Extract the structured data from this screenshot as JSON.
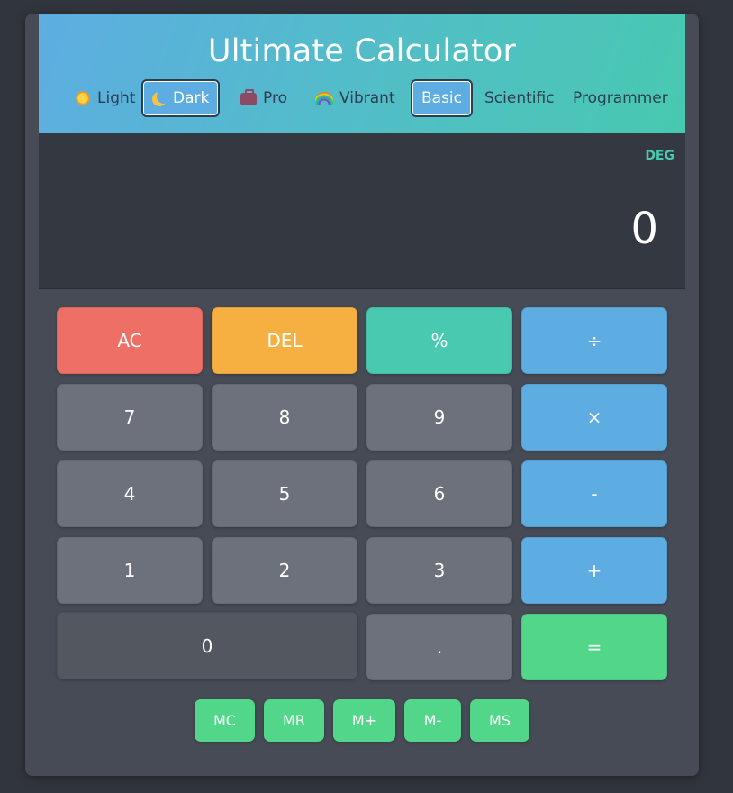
{
  "title": "Ultimate Calculator",
  "themes": [
    {
      "label": "Light",
      "icon": "sun-icon"
    },
    {
      "label": "Dark",
      "icon": "moon-icon",
      "active": true
    },
    {
      "label": "Pro",
      "icon": "briefcase-icon"
    },
    {
      "label": "Vibrant",
      "icon": "rainbow-icon"
    }
  ],
  "modes": [
    {
      "label": "Basic",
      "active": true
    },
    {
      "label": "Scientific"
    },
    {
      "label": "Programmer"
    }
  ],
  "display": {
    "angle_mode": "DEG",
    "value": "0"
  },
  "keys": {
    "ac": "AC",
    "del": "DEL",
    "percent": "%",
    "divide": "÷",
    "seven": "7",
    "eight": "8",
    "nine": "9",
    "multiply": "×",
    "four": "4",
    "five": "5",
    "six": "6",
    "minus": "-",
    "one": "1",
    "two": "2",
    "three": "3",
    "plus": "+",
    "zero": "0",
    "dot": ".",
    "equals": "="
  },
  "memory": [
    "MC",
    "MR",
    "M+",
    "M-",
    "MS"
  ],
  "colors": {
    "header_start": "#5dade2",
    "header_end": "#48c9b0",
    "clear": "#ee6f66",
    "delete": "#f5b041",
    "percent": "#48c9b0",
    "operator": "#5dade2",
    "equals": "#52d68a",
    "memory": "#52d68a",
    "number": "#6c717b",
    "display_bg": "#343840",
    "body_bg": "#464b55"
  }
}
